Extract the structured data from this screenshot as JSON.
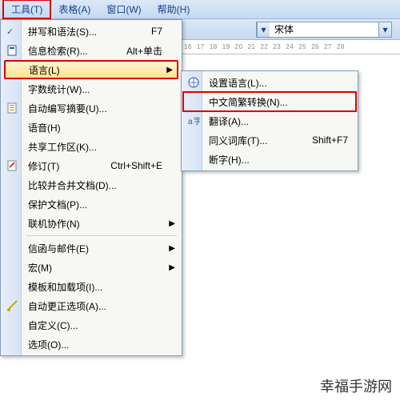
{
  "menubar": {
    "tools": "工具(T)",
    "table": "表格(A)",
    "window": "窗口(W)",
    "help": "帮助(H)"
  },
  "toolbar": {
    "font_name": "宋体"
  },
  "ruler": {
    "ticks": [
      "16",
      "17",
      "18",
      "19",
      "20",
      "21",
      "22",
      "23",
      "24",
      "25",
      "26",
      "27",
      "28"
    ]
  },
  "tools_menu": {
    "spelling": {
      "label": "拼写和语法(S)...",
      "shortcut": "F7"
    },
    "research": {
      "label": "信息检索(R)...",
      "shortcut": "Alt+单击"
    },
    "language": {
      "label": "语言(L)"
    },
    "wordcount": {
      "label": "字数统计(W)..."
    },
    "autosummary": {
      "label": "自动编写摘要(U)..."
    },
    "speech": {
      "label": "语音(H)"
    },
    "shared_workspace": {
      "label": "共享工作区(K)..."
    },
    "track_changes": {
      "label": "修订(T)",
      "shortcut": "Ctrl+Shift+E"
    },
    "compare_merge": {
      "label": "比较并合并文档(D)..."
    },
    "protect": {
      "label": "保护文档(P)..."
    },
    "online_collab": {
      "label": "联机协作(N)"
    },
    "letters_mail": {
      "label": "信函与邮件(E)"
    },
    "macro": {
      "label": "宏(M)"
    },
    "templates": {
      "label": "模板和加载项(I)..."
    },
    "autocorrect": {
      "label": "自动更正选项(A)..."
    },
    "customize": {
      "label": "自定义(C)..."
    },
    "options": {
      "label": "选项(O)..."
    }
  },
  "language_submenu": {
    "set_language": {
      "label": "设置语言(L)..."
    },
    "chinese_convert": {
      "label": "中文简繁转换(N)..."
    },
    "translate": {
      "label": "翻译(A)..."
    },
    "thesaurus": {
      "label": "同义词库(T)...",
      "shortcut": "Shift+F7"
    },
    "hyphenation": {
      "label": "断字(H)..."
    }
  },
  "watermark": "幸福手游网"
}
